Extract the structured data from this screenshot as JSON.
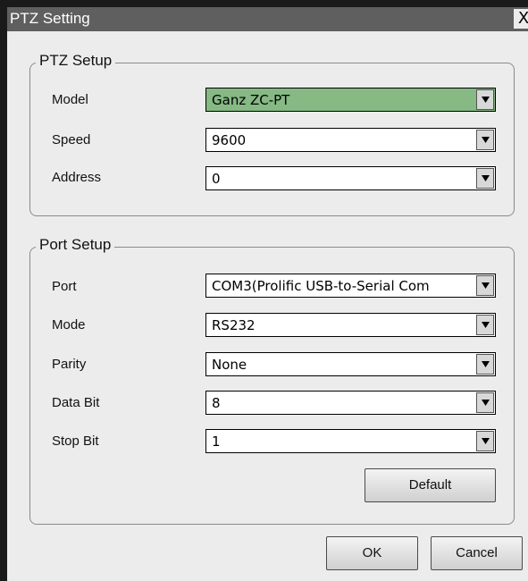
{
  "window": {
    "title": "PTZ Setting",
    "close_label": "X"
  },
  "ptz_setup": {
    "title": "PTZ Setup",
    "fields": [
      {
        "label": "Model",
        "value": "Ganz ZC-PT",
        "highlighted": true,
        "icon": "chevron-down-icon"
      },
      {
        "label": "Speed",
        "value": "9600",
        "icon": "chevron-down-icon"
      },
      {
        "label": "Address",
        "value": "0",
        "icon": "chevron-down-icon"
      }
    ]
  },
  "port_setup": {
    "title": "Port Setup",
    "fields": [
      {
        "label": "Port",
        "value": "COM3(Prolific USB-to-Serial Com",
        "icon": "chevron-down-icon"
      },
      {
        "label": "Mode",
        "value": "RS232",
        "icon": "chevron-down-icon"
      },
      {
        "label": "Parity",
        "value": "None",
        "icon": "chevron-down-icon"
      },
      {
        "label": "Data Bit",
        "value": "8",
        "icon": "chevron-down-icon"
      },
      {
        "label": "Stop Bit",
        "value": "1",
        "icon": "chevron-down-icon"
      }
    ],
    "default_label": "Default"
  },
  "buttons": {
    "ok": "OK",
    "cancel": "Cancel"
  },
  "colors": {
    "titlebar": "#5f5f5f",
    "dialog": "#ececec",
    "highlight": "#86b984"
  }
}
